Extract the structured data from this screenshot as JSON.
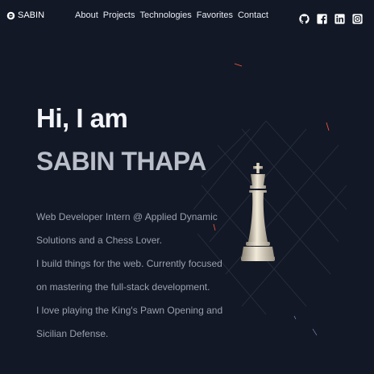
{
  "header": {
    "logo_text": "SABIN",
    "nav": [
      {
        "label": "About"
      },
      {
        "label": "Projects"
      },
      {
        "label": "Technologies"
      },
      {
        "label": "Favorites"
      },
      {
        "label": "Contact"
      }
    ],
    "social_icons": [
      "github-icon",
      "facebook-icon",
      "linkedin-icon",
      "instagram-icon"
    ]
  },
  "hero": {
    "greeting": "Hi, I am",
    "name": "SABIN THAPA",
    "bio_lines": [
      "Web Developer Intern @ Applied Dynamic",
      "Solutions and a Chess Lover.",
      "I build things for the web. Currently focused",
      "on mastering the full-stack development.",
      "I love playing the King's Pawn Opening and",
      "Sicilian Defense."
    ]
  },
  "decor": {
    "piece": "king-chess-piece"
  },
  "colors": {
    "background": "#121826",
    "heading": "#f2f4f8",
    "name": "#b9bec9",
    "body_text": "#9aa0ab",
    "accent": "#ff5a3c"
  }
}
